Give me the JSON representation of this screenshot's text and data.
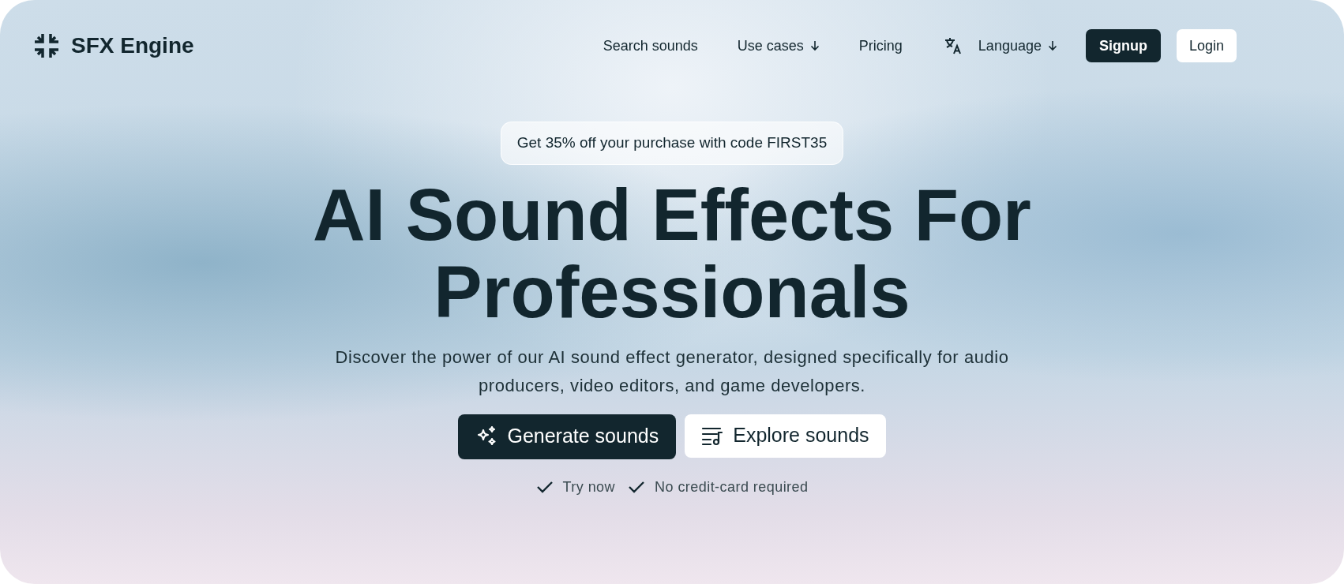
{
  "logo": {
    "text": "SFX Engine"
  },
  "nav": [
    {
      "kind": "link",
      "label": "Search sounds",
      "dropdown": false
    },
    {
      "kind": "link",
      "label": "Use cases",
      "dropdown": true
    },
    {
      "kind": "link",
      "label": "Pricing",
      "dropdown": false
    },
    {
      "kind": "language",
      "label": "Language",
      "dropdown": true
    }
  ],
  "auth_buttons": [
    {
      "kind": "primary",
      "label": "Signup"
    },
    {
      "kind": "secondary",
      "label": "Login"
    }
  ],
  "promo": "Get 35% off your purchase with code FIRST35",
  "headline": [
    "AI Sound Effects For",
    "Professionals"
  ],
  "subtitle": "Discover the power of our AI sound effect generator, designed specifically for audio producers, video editors, and game developers.",
  "cta_buttons": [
    {
      "kind": "primary",
      "label": "Generate sounds"
    },
    {
      "kind": "secondary",
      "label": "Explore sounds"
    }
  ],
  "perks": [
    "Try now",
    "No credit-card required"
  ]
}
